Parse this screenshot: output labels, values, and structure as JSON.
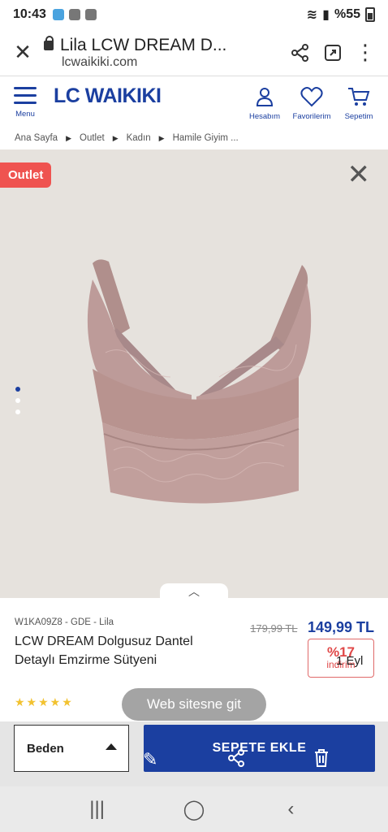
{
  "status": {
    "time": "10:43",
    "battery": "%55"
  },
  "browser": {
    "title": "Lila LCW DREAM D...",
    "url": "lcwaikiki.com"
  },
  "header": {
    "logo": "LC WAIKIKI",
    "menu_label": "Menu",
    "account_label": "Hesabım",
    "favorites_label": "Favorilerim",
    "cart_label": "Sepetim"
  },
  "breadcrumb": [
    "Ana Sayfa",
    "Outlet",
    "Kadın",
    "Hamile Giyim ..."
  ],
  "gallery": {
    "badge": "Outlet",
    "image_count": 3,
    "active_index": 0
  },
  "product": {
    "sku": "W1KA09Z8 - GDE - Lila",
    "name": "LCW DREAM Dolgusuz Dantel Detaylı Emzirme Sütyeni",
    "old_price": "179,99 TL",
    "price": "149,99 TL",
    "discount_pct": "%17",
    "discount_label": "indirim",
    "overlay_text": "1 Eyl",
    "rating_stars": 5
  },
  "toast": "Web sitesne git",
  "actions": {
    "size_label": "Beden",
    "add_to_cart": "SEPETE EKLE"
  },
  "colors": {
    "brand": "#1b3fa0",
    "outlet": "#ef5350",
    "discount": "#e04848"
  }
}
